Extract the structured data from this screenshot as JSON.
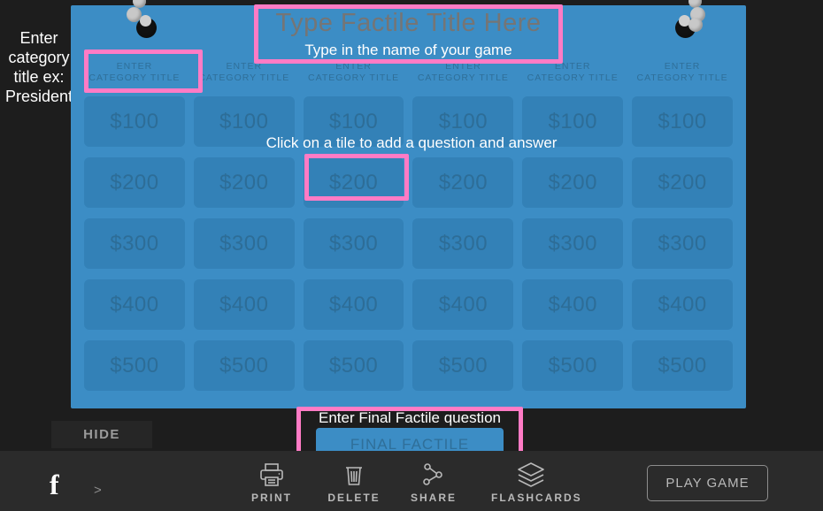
{
  "side_hint": "Enter category title ex: President",
  "board": {
    "title_placeholder": "Type Factile Title Here",
    "title_value": "",
    "title_sub": "Type in the name of your game",
    "click_hint": "Click on a tile to add a question and answer",
    "category_label": "ENTER\nCATEGORY TITLE",
    "categories": [
      "ENTER CATEGORY TITLE",
      "ENTER CATEGORY TITLE",
      "ENTER CATEGORY TITLE",
      "ENTER CATEGORY TITLE",
      "ENTER CATEGORY TITLE",
      "ENTER CATEGORY TITLE"
    ],
    "rows": [
      {
        "value": "$100",
        "tiles": [
          "$100",
          "$100",
          "$100",
          "$100",
          "$100",
          "$100"
        ]
      },
      {
        "value": "$200",
        "tiles": [
          "$200",
          "$200",
          "$200",
          "$200",
          "$200",
          "$200"
        ]
      },
      {
        "value": "$300",
        "tiles": [
          "$300",
          "$300",
          "$300",
          "$300",
          "$300",
          "$300"
        ]
      },
      {
        "value": "$400",
        "tiles": [
          "$400",
          "$400",
          "$400",
          "$400",
          "$400",
          "$400"
        ]
      },
      {
        "value": "$500",
        "tiles": [
          "$500",
          "$500",
          "$500",
          "$500",
          "$500",
          "$500"
        ]
      }
    ],
    "colors": {
      "board_blue": "#3c8dc5",
      "tile_blue": "#3381b7",
      "tile_text": "#2d6d97",
      "highlight_pink": "#ff7bc5"
    }
  },
  "final": {
    "label": "Enter Final Factile question",
    "tile_label": "FINAL FACTILE"
  },
  "hide_button": "HIDE",
  "toolbar": {
    "facebook_icon": "facebook-icon",
    "next_arrow": ">",
    "items": [
      {
        "label": "PRINT",
        "icon": "printer-icon"
      },
      {
        "label": "DELETE",
        "icon": "trash-icon"
      },
      {
        "label": "SHARE",
        "icon": "share-nodes-icon"
      },
      {
        "label": "FLASHCARDS",
        "icon": "layers-icon"
      }
    ],
    "play_button": "PLAY GAME"
  }
}
